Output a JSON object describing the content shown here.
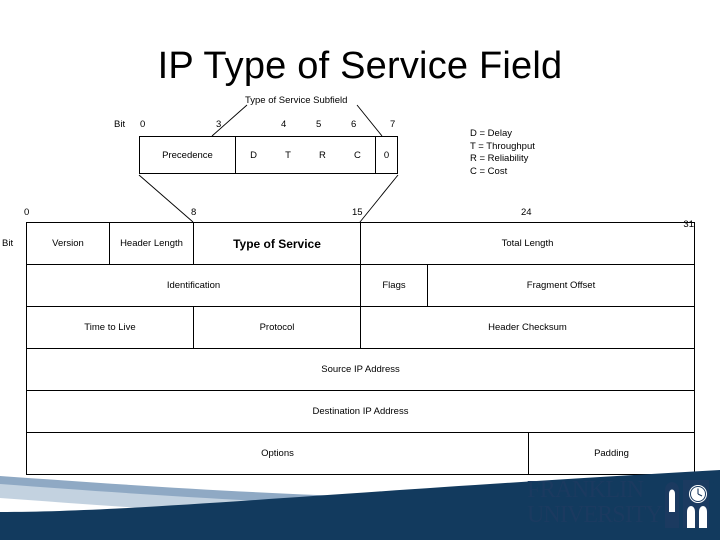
{
  "slide": {
    "title": "IP Type of Service Field"
  },
  "subfield": {
    "caption": "Type of Service Subfield",
    "bit_word": "Bit",
    "bit_labels": [
      "0",
      "3",
      "4",
      "5",
      "6",
      "7"
    ],
    "cells": [
      {
        "label": "Precedence"
      },
      {
        "label": "D"
      },
      {
        "label": "T"
      },
      {
        "label": "R"
      },
      {
        "label": "C"
      },
      {
        "label": "0"
      }
    ]
  },
  "legend": {
    "lines": [
      "D = Delay",
      "T = Throughput",
      "R = Reliability",
      "C = Cost"
    ]
  },
  "ip_header": {
    "bit_word": "Bit",
    "bit_labels": [
      "0",
      "8",
      "15",
      "24",
      "31"
    ],
    "rows": [
      {
        "cells": [
          {
            "label": "Version",
            "emphasis": false
          },
          {
            "label": "Header Length",
            "emphasis": false
          },
          {
            "label": "Type of Service",
            "emphasis": true
          },
          {
            "label": "Total Length",
            "emphasis": false
          }
        ]
      },
      {
        "cells": [
          {
            "label": "Identification",
            "emphasis": false
          },
          {
            "label": "Flags",
            "emphasis": false
          },
          {
            "label": "Fragment Offset",
            "emphasis": false
          }
        ]
      },
      {
        "cells": [
          {
            "label": "Time to Live",
            "emphasis": false
          },
          {
            "label": "Protocol",
            "emphasis": false
          },
          {
            "label": "Header Checksum",
            "emphasis": false
          }
        ]
      },
      {
        "cells": [
          {
            "label": "Source IP Address",
            "emphasis": false
          }
        ]
      },
      {
        "cells": [
          {
            "label": "Destination IP Address",
            "emphasis": false
          }
        ]
      },
      {
        "cells": [
          {
            "label": "Options",
            "emphasis": false
          },
          {
            "label": "Padding",
            "emphasis": false
          }
        ]
      }
    ]
  },
  "branding": {
    "line1": "FRANKLIN",
    "line2": "UNIVERSITY",
    "logo_icon": "bell-tower-icon"
  },
  "colors": {
    "navy": "#123A5E",
    "light_blue": "#8FA9C4",
    "pale_blue": "#B9CADB",
    "logo_navy": "#1b3a60",
    "line": "#000000",
    "background": "#ffffff"
  }
}
